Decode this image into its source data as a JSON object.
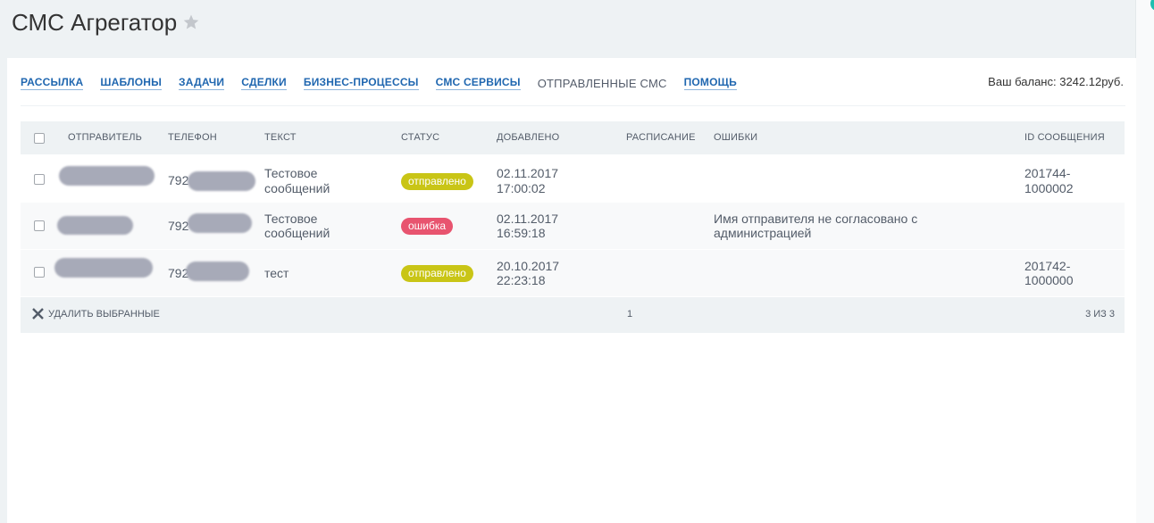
{
  "page": {
    "title": "СМС Агрегатор"
  },
  "nav": {
    "items": [
      {
        "label": "РАССЫЛКА",
        "active": false
      },
      {
        "label": "ШАБЛОНЫ",
        "active": false
      },
      {
        "label": "ЗАДАЧИ",
        "active": false
      },
      {
        "label": "СДЕЛКИ",
        "active": false
      },
      {
        "label": "БИЗНЕС-ПРОЦЕССЫ",
        "active": false
      },
      {
        "label": "СМС СЕРВИСЫ",
        "active": false
      },
      {
        "label": "ОТПРАВЛЕННЫЕ СМС",
        "active": true
      },
      {
        "label": "ПОМОЩЬ",
        "active": false
      }
    ],
    "balance": "Ваш баланс: 3242.12руб."
  },
  "table": {
    "headers": {
      "sender": "ОТПРАВИТЕЛЬ",
      "phone": "ТЕЛЕФОН",
      "text": "ТЕКСТ",
      "status": "СТАТУС",
      "added": "ДОБАВЛЕНО",
      "schedule": "РАСПИСАНИЕ",
      "errors": "ОШИБКИ",
      "message_id": "ID СООБЩЕНИЯ"
    },
    "rows": [
      {
        "phone_prefix": "792",
        "text_line1": "Тестовое",
        "text_line2": "сообщений",
        "status": "отправлено",
        "added_date": "02.11.2017",
        "added_time": "17:00:02",
        "schedule": "",
        "error_line1": "",
        "error_line2": "",
        "id_line1": "201744-",
        "id_line2": "1000002"
      },
      {
        "phone_prefix": "792",
        "text_line1": "Тестовое",
        "text_line2": "сообщений",
        "status": "ошибка",
        "added_date": "02.11.2017",
        "added_time": "16:59:18",
        "schedule": "",
        "error_line1": "Имя отправителя не согласовано с",
        "error_line2": "администрацией",
        "id_line1": "",
        "id_line2": ""
      },
      {
        "phone_prefix": "792",
        "text_line1": "тест",
        "text_line2": "",
        "status": "отправлено",
        "added_date": "20.10.2017",
        "added_time": "22:23:18",
        "schedule": "",
        "error_line1": "",
        "error_line2": "",
        "id_line1": "201742-",
        "id_line2": "1000000"
      }
    ],
    "footer": {
      "delete_label": "УДАЛИТЬ ВЫБРАННЫЕ",
      "page": "1",
      "count": "3 ИЗ 3"
    }
  },
  "colors": {
    "link": "#2067b0",
    "status_sent": "#c9c516",
    "status_error": "#e8546f",
    "header_bg": "#eef2f4"
  },
  "icons": {
    "favorite": "star-icon",
    "delete": "close-icon"
  }
}
